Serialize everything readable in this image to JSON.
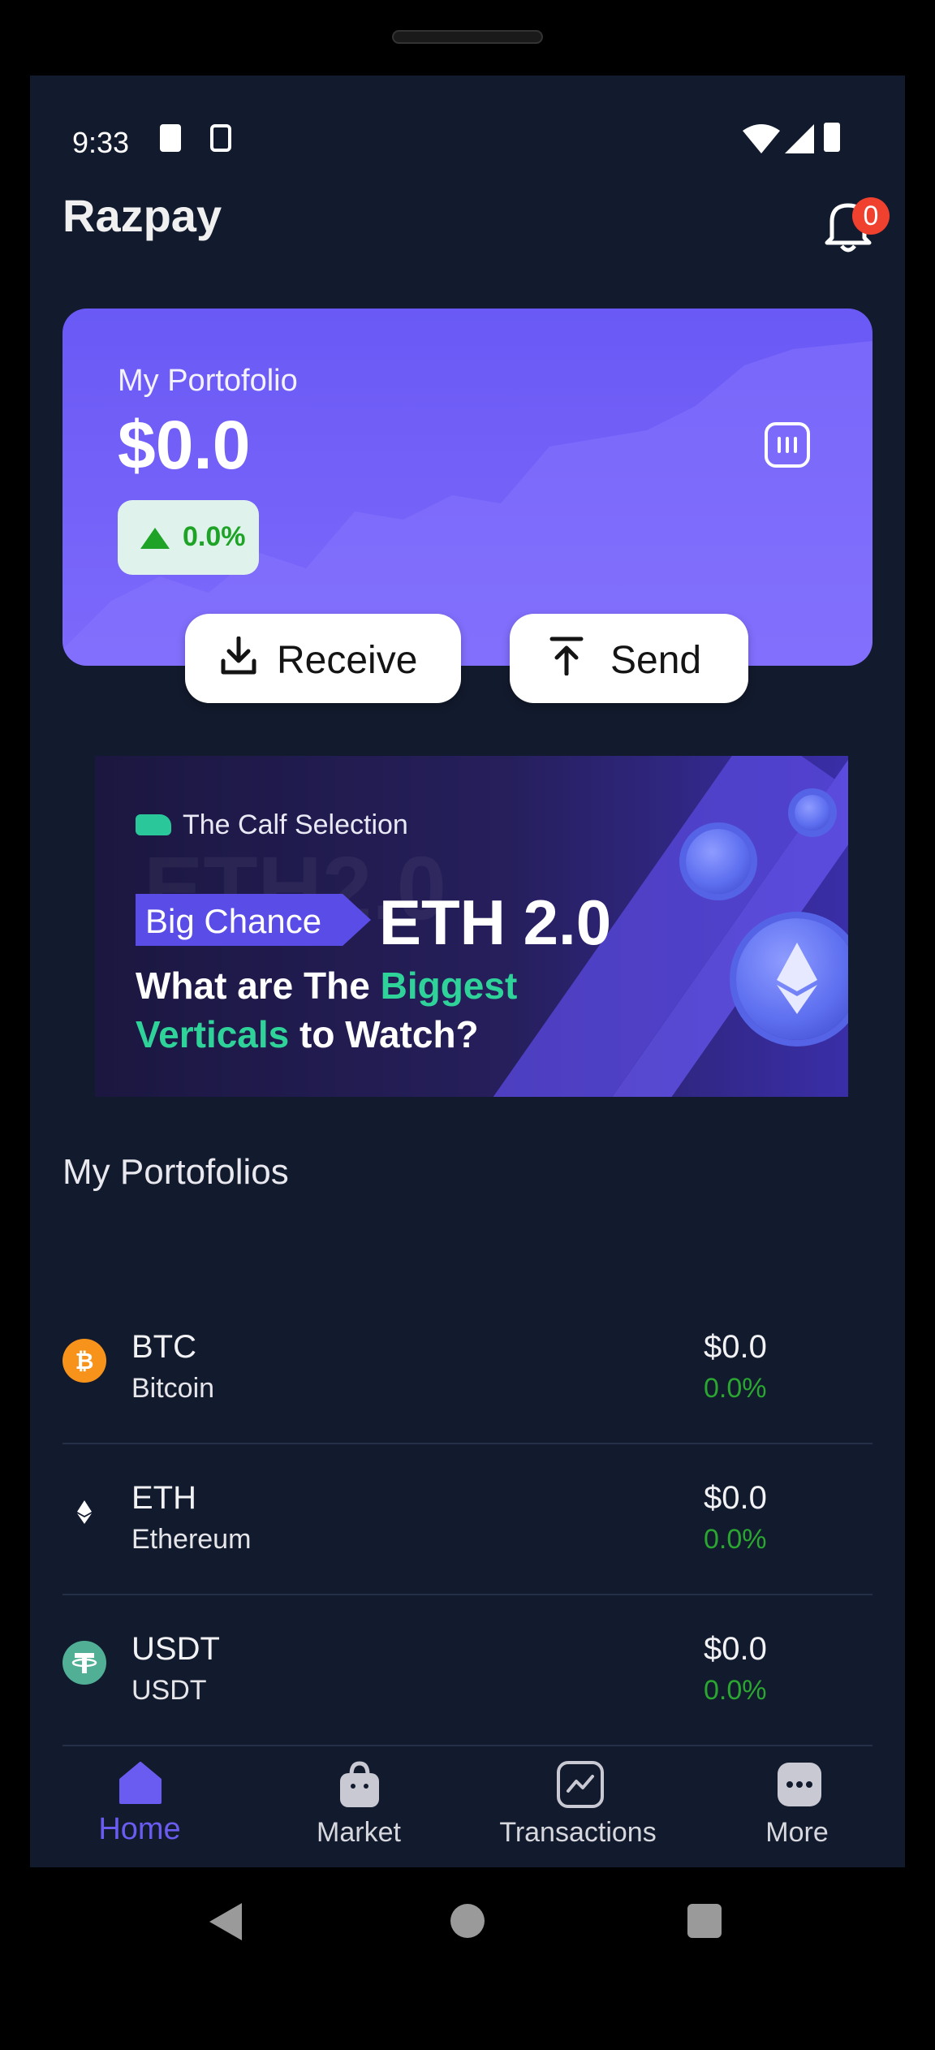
{
  "status_bar": {
    "time": "9:33"
  },
  "header": {
    "title": "Razpay",
    "notification_count": "0"
  },
  "portfolio_card": {
    "label": "My Portofolio",
    "balance": "$0.0",
    "change": "0.0%",
    "receive_label": "Receive",
    "send_label": "Send"
  },
  "banner": {
    "brand": "The Calf Selection",
    "tag": "Big Chance",
    "headline": "ETH 2.0",
    "ghost_text": "ETH2.0",
    "line1_a": "What are The ",
    "line1_b": "Biggest",
    "line2_a": "Verticals",
    "line2_b": " to Watch?"
  },
  "portfolio_list": {
    "title": "My Portofolios",
    "items": [
      {
        "symbol": "BTC",
        "name": "Bitcoin",
        "value": "$0.0",
        "change": "0.0%",
        "icon": "bitcoin-icon",
        "color": "#f7931a"
      },
      {
        "symbol": "ETH",
        "name": "Ethereum",
        "value": "$0.0",
        "change": "0.0%",
        "icon": "ethereum-icon",
        "color": "#121a2d"
      },
      {
        "symbol": "USDT",
        "name": "USDT",
        "value": "$0.0",
        "change": "0.0%",
        "icon": "tether-icon",
        "color": "#50af95"
      }
    ]
  },
  "bottom_nav": [
    {
      "label": "Home",
      "icon": "home-icon",
      "active": true
    },
    {
      "label": "Market",
      "icon": "shopping-bag-icon",
      "active": false
    },
    {
      "label": "Transactions",
      "icon": "chart-icon",
      "active": false
    },
    {
      "label": "More",
      "icon": "more-icon",
      "active": false
    }
  ],
  "colors": {
    "background": "#121a2d",
    "accent": "#6a5cf0",
    "positive": "#2aa631",
    "badge": "#f0412f"
  }
}
